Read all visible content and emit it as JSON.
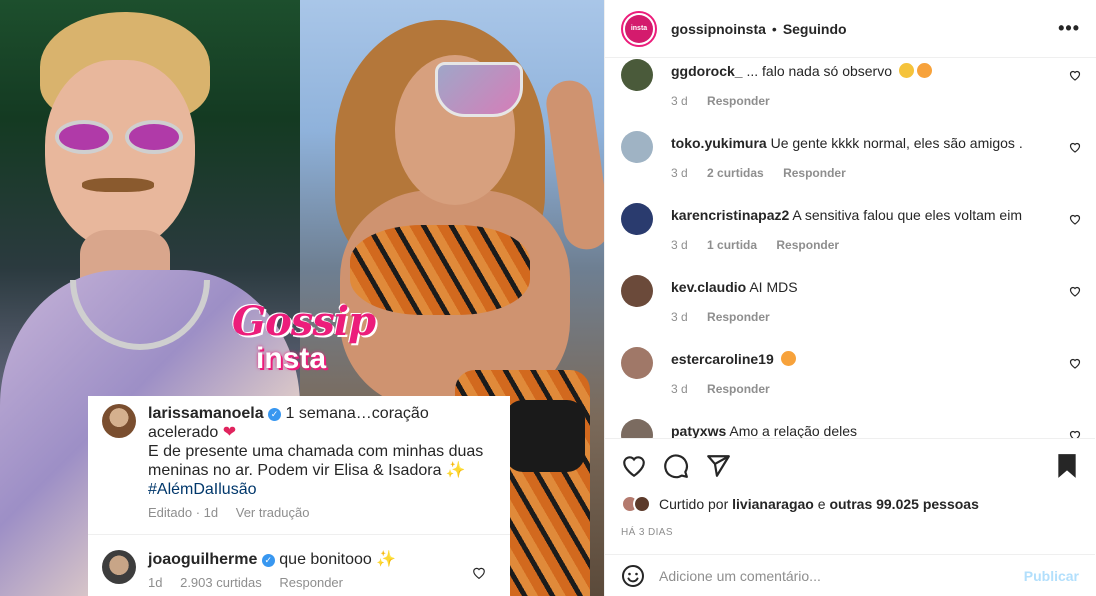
{
  "post": {
    "account": "gossipnoinsta",
    "separator": "•",
    "follow_state": "Seguindo",
    "more": "•••"
  },
  "image": {
    "brand_top": "Gossip",
    "brand_bottom": "insta",
    "card": {
      "c1_user": "larissamanoela",
      "c1_text_1": "1 semana…coração acelerado",
      "c1_text_2": "E de presente uma chamada com minhas duas meninas no ar. Podem vir Elisa & Isadora ✨",
      "c1_tag": "#AlémDaIlusão",
      "c1_meta_edited": "Editado · 1d",
      "c1_meta_translate": "Ver tradução",
      "c2_user": "joaoguilherme",
      "c2_text": "que bonitooo ✨",
      "c2_time": "1d",
      "c2_likes": "2.903 curtidas",
      "c2_reply": "Responder"
    }
  },
  "comments": [
    {
      "user": "ggdorock_",
      "text": "... falo nada só observo",
      "time": "3 d",
      "likes": "",
      "reply": "Responder",
      "avatar_color": "#4a5a3a"
    },
    {
      "user": "toko.yukimura",
      "text": "Ue gente kkkk normal, eles são amigos .",
      "time": "3 d",
      "likes": "2 curtidas",
      "reply": "Responder",
      "avatar_color": "#9fb3c4"
    },
    {
      "user": "karencristinapaz2",
      "text": "A sensitiva falou que eles voltam eim",
      "time": "3 d",
      "likes": "1 curtida",
      "reply": "Responder",
      "avatar_color": "#2a3b6e"
    },
    {
      "user": "kev.claudio",
      "text": "AI MDS",
      "time": "3 d",
      "likes": "",
      "reply": "Responder",
      "avatar_color": "#6b4a3a"
    },
    {
      "user": "estercaroline19",
      "text": "",
      "time": "3 d",
      "likes": "",
      "reply": "Responder",
      "avatar_color": "#a07868"
    },
    {
      "user": "patyxws",
      "text": "Amo a relação deles",
      "time": "",
      "likes": "",
      "reply": "",
      "avatar_color": "#7b6b60"
    }
  ],
  "actions": {
    "liked_by_prefix": "Curtido por",
    "liked_by_user": "livianaragao",
    "liked_by_and": "e",
    "liked_by_others": "outras 99.025 pessoas",
    "timestamp": "HÁ 3 DIAS"
  },
  "composer": {
    "placeholder": "Adicione um comentário...",
    "post_label": "Publicar"
  },
  "colors": {
    "accent": "#ec1d7b",
    "link": "#00376b",
    "publish_disabled": "#b2dffc"
  }
}
